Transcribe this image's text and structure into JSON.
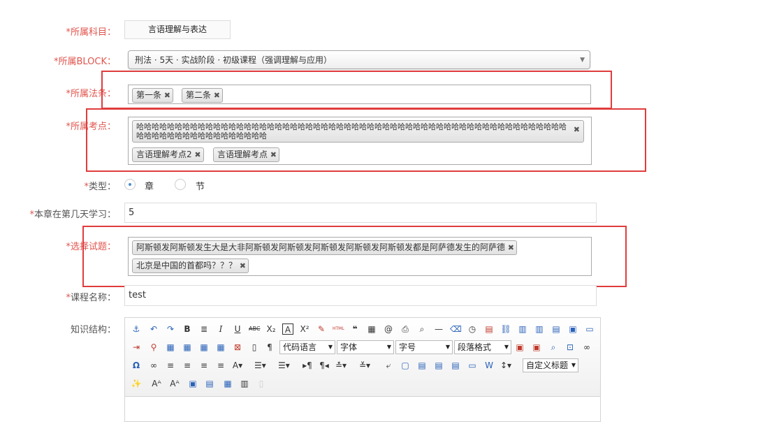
{
  "form": {
    "subject": {
      "required": "*",
      "label": "所属科目：",
      "value": "言语理解与表达"
    },
    "block": {
      "required": "*",
      "label": "所属BLOCK：",
      "value": "刑法 · 5天 · 实战阶段 · 初级课程（强调理解与应用）"
    },
    "law": {
      "required": "*",
      "label": "所属法条：",
      "tags": [
        "第一条",
        "第二条"
      ]
    },
    "point": {
      "required": "*",
      "label": "所属考点：",
      "tags": [
        "哈哈哈哈哈哈哈哈哈哈哈哈哈哈哈哈哈哈哈哈哈哈哈哈哈哈哈哈哈哈哈哈哈哈哈哈哈哈哈哈哈哈哈哈哈哈哈哈哈哈哈哈哈哈哈哈哈哈哈哈哈哈哈哈哈哈哈哈哈哈哈哈哈",
        "言语理解考点2",
        "言语理解考点"
      ]
    },
    "type": {
      "required": "*",
      "label": "类型：",
      "options": [
        "章",
        "节"
      ],
      "selected": "章"
    },
    "day": {
      "required": "*",
      "label": "本章在第几天学习：",
      "value": "5"
    },
    "questions": {
      "required": "*",
      "label": "选择试题：",
      "tags": [
        "阿斯顿发阿斯顿发生大是大非阿斯顿发阿斯顿发阿斯顿发阿斯顿发阿斯顿发都是阿萨德发生的阿萨德",
        "北京是中国的首都吗？？？"
      ]
    },
    "course": {
      "required": "*",
      "label": "课程名称：",
      "value": "test"
    },
    "knowledge": {
      "label": "知识结构："
    }
  },
  "editor": {
    "dropdowns": [
      "代码语言",
      "字体",
      "字号",
      "段落格式",
      "自定义标题"
    ],
    "tag_remove_glyph": "✖"
  },
  "colors": {
    "required": "#e0554e",
    "highlight": "#e03c3c",
    "radio_selected": "#4a8fd0"
  }
}
